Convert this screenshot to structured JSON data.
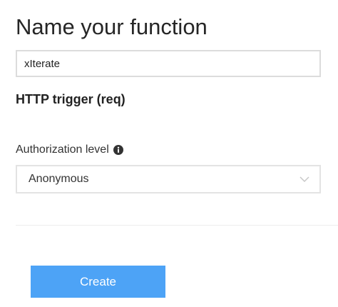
{
  "form": {
    "title": "Name your function",
    "name_value": "xIterate",
    "trigger_label": "HTTP trigger (req)",
    "auth_label": "Authorization level",
    "auth_selected": "Anonymous",
    "create_label": "Create"
  },
  "icons": {
    "info": "info-circle-icon",
    "dropdown": "chevron-down-icon"
  },
  "colors": {
    "accent": "#4da3f6",
    "input_border": "#dcdcdc",
    "text": "#222222"
  }
}
